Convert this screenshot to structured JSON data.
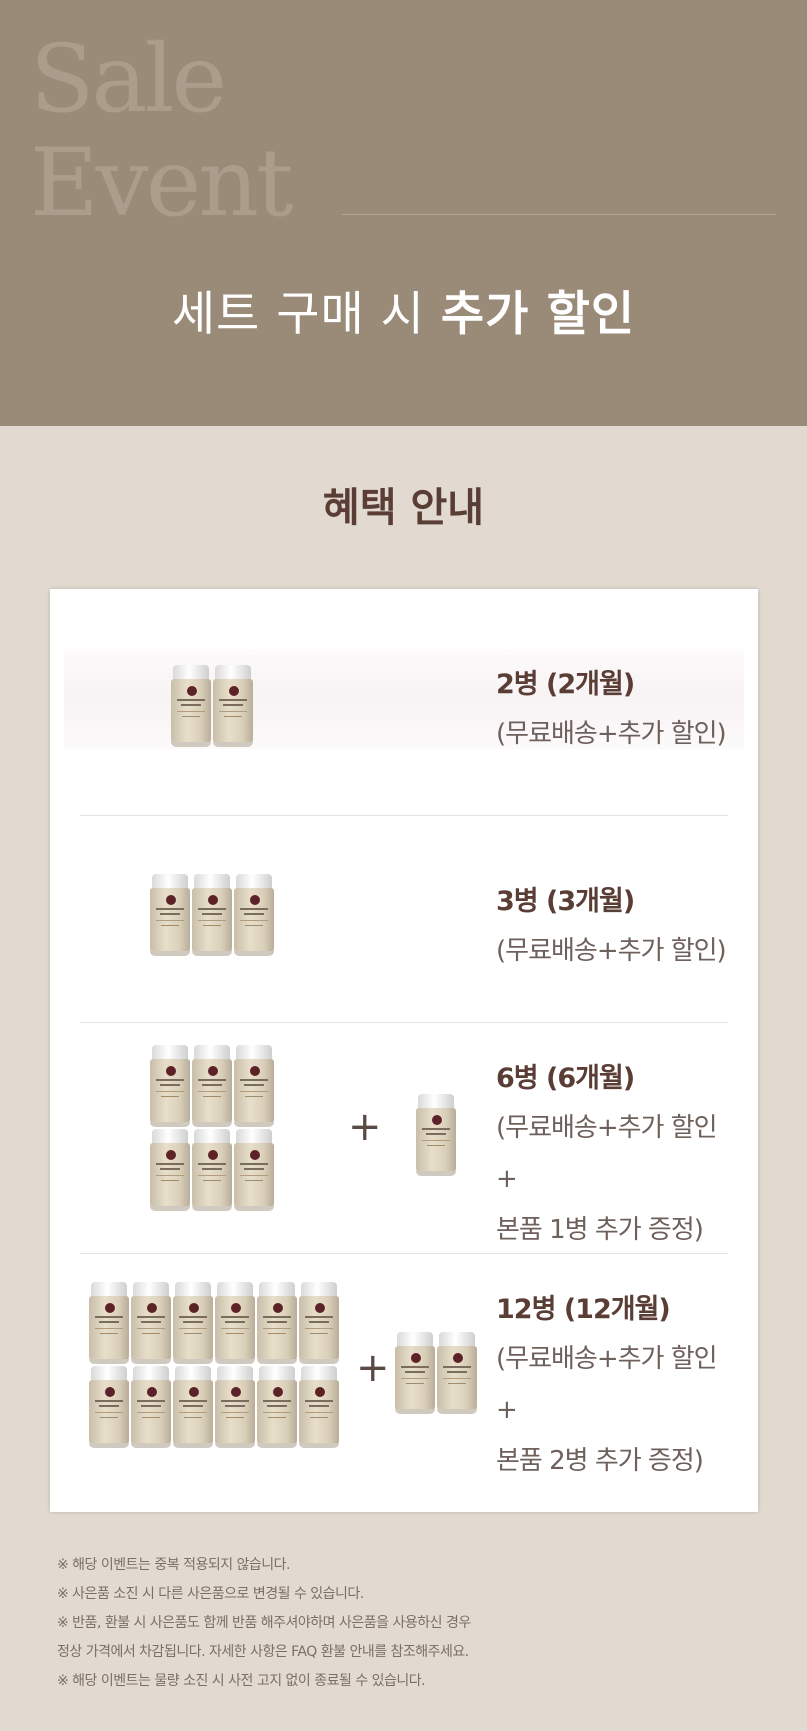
{
  "hero": {
    "bg_text": "Sale\nEvent",
    "heading_light": "세트 구매 시 ",
    "heading_strong": "추가 할인"
  },
  "benefit": {
    "title": "혜택 안내"
  },
  "offers": [
    {
      "count": "2병 (2개월)",
      "desc": "(무료배송+추가 할인)"
    },
    {
      "count": "3병 (3개월)",
      "desc": "(무료배송+추가 할인)"
    },
    {
      "count": "6병 (6개월)",
      "desc": "(무료배송+추가 할인+\n본품 1병 추가 증정)"
    },
    {
      "count": "12병 (12개월)",
      "desc": "(무료배송+추가 할인+\n본품 2병 추가 증정)"
    }
  ],
  "plus": "+",
  "notes": [
    "※ 해당 이벤트는 중복 적용되지 않습니다.",
    "※ 사은품 소진 시 다른 사은품으로 변경될 수 있습니다.",
    "※ 반품, 환불 시 사은품도 함께 반품 해주셔야하며 사은품을 사용하신 경우\n    정상 가격에서 차감됩니다. 자세한 사항은 FAQ 환불 안내를 참조해주세요.",
    "※ 해당 이벤트는 물량 소진 시 사전 고지 없이 종료될 수 있습니다."
  ],
  "colors": {
    "hero_bg": "#9a8a78",
    "page_bg": "#e2dad0",
    "title_brown": "#5a3e36"
  },
  "product_icon": "supplement-bottle-icon"
}
